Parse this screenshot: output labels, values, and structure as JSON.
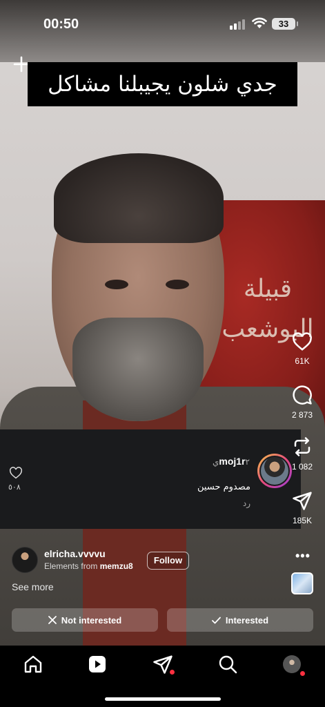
{
  "status_bar": {
    "time": "00:50",
    "battery": "33"
  },
  "video": {
    "caption": "جدي شلون يجيبلنا مشاكل",
    "plaque_text": "قبيلة البوشعب"
  },
  "comment": {
    "username": "moj1r",
    "time": "٢ي",
    "text": "مصدوم حسين",
    "reply_label": "رد",
    "like_count": "٥٠٨"
  },
  "actions": {
    "likes": "61K",
    "comments": "2 873",
    "reposts": "1 082",
    "shares": "185K"
  },
  "author": {
    "username": "elricha.vvvvu",
    "audio_prefix": "Elements from",
    "audio_source": "memzu8",
    "follow_label": "Follow",
    "see_more": "See more"
  },
  "feedback": {
    "not_interested": "Not interested",
    "interested": "Interested"
  },
  "tabs": [
    "home",
    "reels",
    "messages",
    "search",
    "profile"
  ],
  "colors": {
    "notification_dot": "#ff3040",
    "comment_panel": "#1a1b1d"
  }
}
